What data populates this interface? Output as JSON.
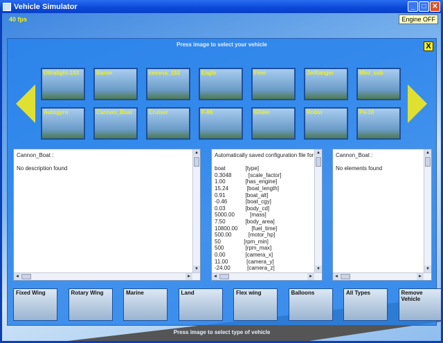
{
  "window": {
    "title": "Vehicle Simulator",
    "buttons": [
      "minimize",
      "maximize",
      "close"
    ]
  },
  "hud": {
    "fps": "40 fps",
    "engine": "Engine OFF"
  },
  "panel": {
    "top_text": "Press image to select your vehicle",
    "bottom_text": "Press image to select type of vehicle",
    "close_label": "X"
  },
  "vehicles_row1": [
    "Ultralight-103",
    "Baron",
    "cessna_152",
    "Eagle",
    "Finn",
    "JetRanger",
    "Mini_sub"
  ],
  "vehicles_row2": [
    "Autogyro",
    "Cannon_Boat",
    "Cruiser",
    "F-86",
    "Glider",
    "Robin",
    "Pa-18"
  ],
  "description": {
    "text": "Cannon_Boat :\n\nNo description found"
  },
  "config": {
    "text": "Automatically saved configuration file for\n\nboat             [type]\n0.3048           [scale_factor]\n1.00             [has_engine]\n15.24            [boat_length]\n0.91             [boat_alt]\n-0.46            [boat_cgy]\n0.03             [body_cd]\n5000.00          [mass]\n7.50             [body_area]\n10800.00         [fuel_time]\n500.00           [motor_hp]\n50               [rpm_min]\n500              [rpm_max]\n0.00             [camera_x]\n11.00            [camera_y]\n-24.00           [camera_z]"
  },
  "elements": {
    "text": "Cannon_Boat :\n\nNo elements found"
  },
  "categories": [
    "Fixed Wing",
    "Rotary Wing",
    "Marine",
    "Land",
    "Flex wing",
    "Balloons",
    "All Types",
    "Remove\nVehicle"
  ],
  "colors": {
    "accent": "#f0f020",
    "panel": "#2882eb",
    "titlebar": "#0a48d8"
  }
}
